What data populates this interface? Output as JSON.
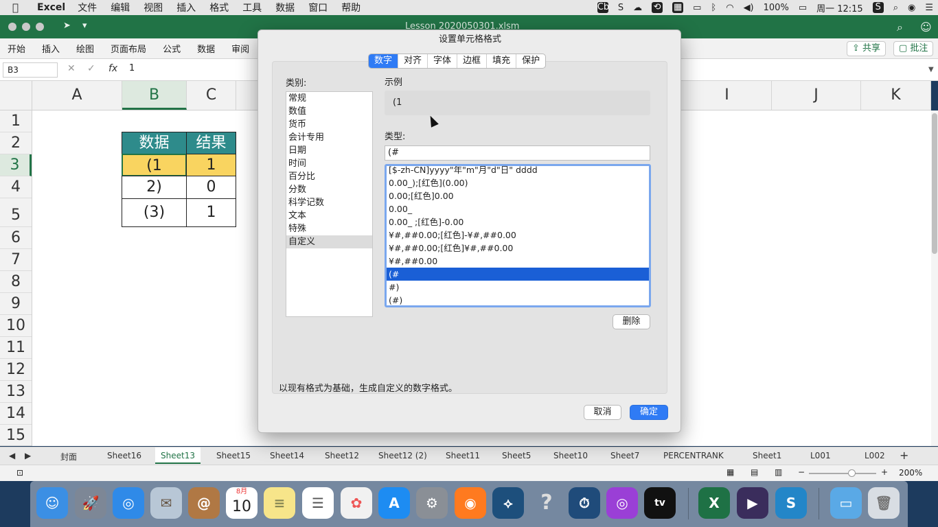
{
  "menubar": {
    "app": "Excel",
    "menus": [
      "文件",
      "编辑",
      "视图",
      "插入",
      "格式",
      "工具",
      "数据",
      "窗口",
      "帮助"
    ],
    "battery": "100%",
    "clock": "周一 12:15"
  },
  "window": {
    "title": "Lesson 2020050301.xlsm",
    "ribbon_tabs": [
      "开始",
      "插入",
      "绘图",
      "页面布局",
      "公式",
      "数据",
      "审阅"
    ],
    "share": "共享",
    "comments": "批注"
  },
  "formula_bar": {
    "name_box": "B3",
    "fx": "fx",
    "value": "1"
  },
  "columns": [
    "A",
    "B",
    "C",
    "I",
    "J",
    "K"
  ],
  "rows": [
    "1",
    "2",
    "3",
    "4",
    "5",
    "6",
    "7",
    "8",
    "9",
    "10",
    "11",
    "12",
    "13",
    "14",
    "15"
  ],
  "table": {
    "headers": [
      "数据",
      "结果"
    ],
    "rows": [
      [
        "(1",
        "1"
      ],
      [
        "2)",
        "0"
      ],
      [
        "(3)",
        "1"
      ]
    ]
  },
  "sheet_tabs": [
    "封面",
    "Sheet16",
    "Sheet13",
    "Sheet15",
    "Sheet14",
    "Sheet12",
    "Sheet12 (2)",
    "Sheet11",
    "Sheet5",
    "Sheet10",
    "Sheet7",
    "PERCENTRANK",
    "Sheet1",
    "L001",
    "L002"
  ],
  "active_sheet": "Sheet13",
  "zoom": "200%",
  "dialog": {
    "title": "设置单元格格式",
    "tabs": [
      "数字",
      "对齐",
      "字体",
      "边框",
      "填充",
      "保护"
    ],
    "category_label": "类别:",
    "categories": [
      "常规",
      "数值",
      "货币",
      "会计专用",
      "日期",
      "时间",
      "百分比",
      "分数",
      "科学记数",
      "文本",
      "特殊",
      "自定义"
    ],
    "sample_label": "示例",
    "sample_value": "(1",
    "type_label": "类型:",
    "type_value": "(#",
    "formats": [
      "[$-zh-CN]yyyy\"年\"m\"月\"d\"日\" dddd",
      "0.00_);[红色](0.00)",
      "0.00;[红色]0.00",
      "0.00_",
      "0.00_ ;[红色]-0.00",
      "¥#,##0.00;[红色]-¥#,##0.00",
      "¥#,##0.00;[红色]¥#,##0.00",
      "¥#,##0.00",
      "(#",
      "#)",
      "(#)"
    ],
    "delete": "删除",
    "description": "以现有格式为基础，生成自定义的数字格式。",
    "cancel": "取消",
    "ok": "确定"
  },
  "dock": {
    "calendar_month": "8月",
    "calendar_day": "10",
    "tv": "tv"
  },
  "colors": {
    "excel_green": "#217346",
    "accent_blue": "#2f7bf5",
    "header_teal": "#2e8b8b",
    "highlight": "#f9d460"
  }
}
